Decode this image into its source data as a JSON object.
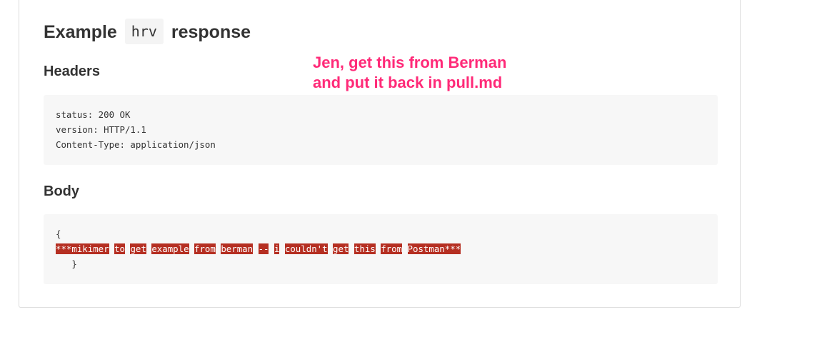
{
  "section": {
    "title_prefix": "Example",
    "title_code": "hrv",
    "title_suffix": "response"
  },
  "headers": {
    "heading": "Headers",
    "lines": [
      "status: 200 OK",
      "version: HTTP/1.1",
      "Content-Type: application/json"
    ]
  },
  "body": {
    "heading": "Body",
    "open_brace": "{",
    "error_words": [
      "***mikimer",
      "to",
      "get",
      "example",
      "from",
      "berman",
      "--",
      "i",
      "couldn't",
      "get",
      "this",
      "from",
      "Postman***"
    ],
    "close_brace": "   }"
  },
  "annotation": {
    "line1": "Jen, get this from Berman",
    "line2": "and put it back in pull.md",
    "color": "#ff2a78"
  },
  "colors": {
    "error_highlight": "#b52f22",
    "code_background": "#f7f7f7"
  }
}
